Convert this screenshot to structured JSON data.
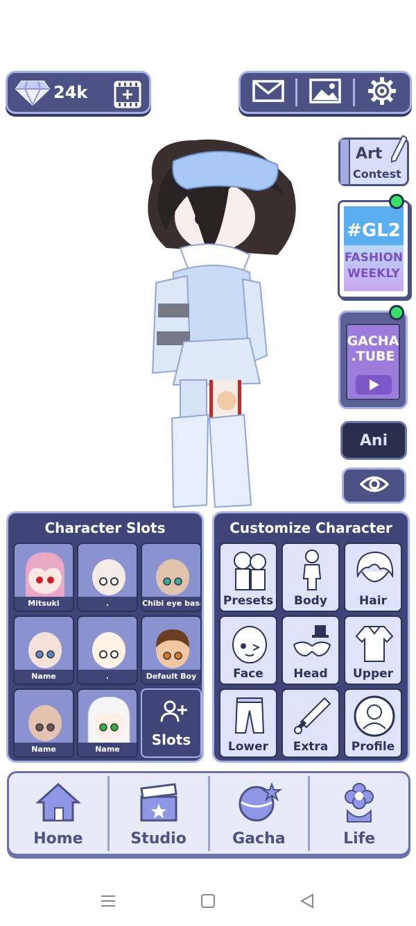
{
  "top_bar": {
    "currency": {
      "icon": "diamond-icon",
      "amount": "24k"
    },
    "film_add_icon": "film-plus-icon",
    "tools": [
      "mail-icon",
      "gallery-icon",
      "settings-gear-icon"
    ]
  },
  "side": {
    "art_contest": {
      "line1": "Art",
      "line2": "Contest"
    },
    "fashion": {
      "tag": "#GL2",
      "line1": "FASHION",
      "line2": "WEEKLY"
    },
    "gachatube": {
      "line1": "GACHA",
      "line2": ".TUBE"
    },
    "ani_label": "Ani",
    "visibility_icon": "eye-icon"
  },
  "slots_panel": {
    "title": "Character Slots",
    "slots": [
      {
        "name": "Mitsuki",
        "hair": "#e9a9c6",
        "eyes": "#d01f2a",
        "skin": "#fbe7e4"
      },
      {
        "name": ".",
        "hair": "",
        "eyes": "#ffffff",
        "skin": "#f4ebe6"
      },
      {
        "name": "Chibi eye base",
        "hair": "",
        "eyes": "#3ea7a0",
        "skin": "#e0c3ac"
      },
      {
        "name": "Name",
        "hair": "",
        "eyes": "#5f87c5",
        "skin": "#f3e1da"
      },
      {
        "name": ".",
        "hair": "",
        "eyes": "#ffffff",
        "skin": "#fff3e6"
      },
      {
        "name": "Default Boy",
        "hair": "#6b3e22",
        "eyes": "#d8772e",
        "skin": "#f1c7a3"
      },
      {
        "name": "Name",
        "hair": "",
        "eyes": "#6b5b4e",
        "skin": "#e4c2b1"
      },
      {
        "name": "Name",
        "hair": "#f5f5f5",
        "eyes": "#32b14a",
        "skin": "#fdeee6"
      }
    ],
    "add_slots_label": "Slots"
  },
  "customize_panel": {
    "title": "Customize Character",
    "categories": [
      "Presets",
      "Body",
      "Hair",
      "Face",
      "Head",
      "Upper",
      "Lower",
      "Extra",
      "Profile"
    ]
  },
  "bottom_nav": [
    "Home",
    "Studio",
    "Gacha",
    "Life"
  ],
  "colors": {
    "panel": "#3f4576",
    "border": "#a9b1e6",
    "accent": "#4c5283",
    "online_dot": "#38e06a"
  }
}
